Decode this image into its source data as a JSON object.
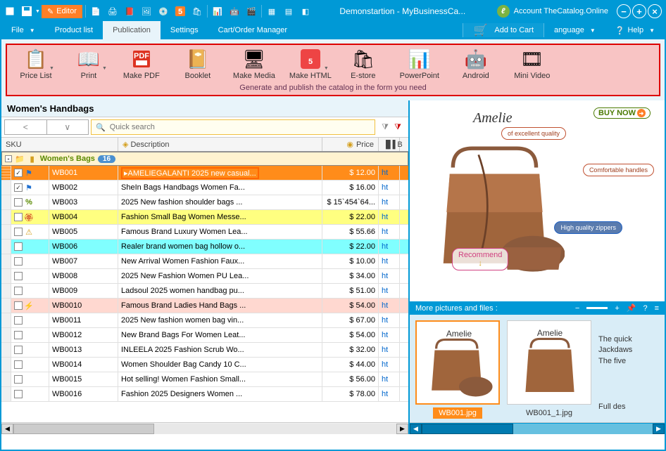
{
  "titlebar": {
    "editor_label": "Editor",
    "title": "Demonstartion - MyBusinessCa...",
    "account": "Account TheCatalog.Online"
  },
  "menubar": {
    "file": "File",
    "product_list": "Product list",
    "publication": "Publication",
    "settings": "Settings",
    "cart": "Cart/Order Manager",
    "add_to_cart": "Add to Cart",
    "language": "anguage",
    "help": "Help"
  },
  "ribbon": {
    "items": [
      "Price List",
      "Print",
      "Make PDF",
      "Booklet",
      "Make Media",
      "Make HTML",
      "E-store",
      "PowerPoint",
      "Android",
      "Mini Video"
    ],
    "desc": "Generate and publish the catalog in the form you need"
  },
  "left": {
    "category": "Women's Handbags",
    "search_placeholder": "Quick search",
    "cols": {
      "sku": "SKU",
      "desc": "Description",
      "price": "Price",
      "b": "B"
    },
    "group": {
      "name": "Women's Bags",
      "count": "16"
    },
    "rows": [
      {
        "sku": "WB001",
        "desc": "AMELIEGALANTI 2025 new casual...",
        "price": "$ 12.00",
        "url": "ht",
        "sel": true,
        "chk": true,
        "ico": "flag-blue"
      },
      {
        "sku": "WB002",
        "desc": "SheIn Bags Handbags Women Fa...",
        "price": "$ 16.00",
        "url": "ht",
        "chk": true,
        "ico": "flag-blue"
      },
      {
        "sku": "WB003",
        "desc": "2025 New fashion shoulder bags ...",
        "price": "$ 15`454`64...",
        "url": "ht",
        "ico": "percent"
      },
      {
        "sku": "WB004",
        "desc": "Fashion Small Bag Women Messe...",
        "price": "$ 22.00",
        "url": "ht",
        "cls": "yellow",
        "ico": "rosette"
      },
      {
        "sku": "WB005",
        "desc": "Famous Brand Luxury Women Lea...",
        "price": "$ 55.66",
        "url": "ht",
        "ico": "warn"
      },
      {
        "sku": "WB006",
        "desc": "Realer brand women bag hollow o...",
        "price": "$ 22.00",
        "url": "ht",
        "cls": "cyan"
      },
      {
        "sku": "WB007",
        "desc": "New Arrival Women Fashion Faux...",
        "price": "$ 10.00",
        "url": "ht"
      },
      {
        "sku": "WB008",
        "desc": "2025 New Fashion Women PU Lea...",
        "price": "$ 34.00",
        "url": "ht"
      },
      {
        "sku": "WB009",
        "desc": "Ladsoul 2025 women handbag pu...",
        "price": "$ 51.00",
        "url": "ht"
      },
      {
        "sku": "WB0010",
        "desc": "Famous Brand Ladies Hand Bags ...",
        "price": "$ 54.00",
        "url": "ht",
        "cls": "pink",
        "ico": "bolt"
      },
      {
        "sku": "WB0011",
        "desc": "2025 New fashion women bag vin...",
        "price": "$ 67.00",
        "url": "ht"
      },
      {
        "sku": "WB0012",
        "desc": "New Brand Bags For Women Leat...",
        "price": "$ 54.00",
        "url": "ht"
      },
      {
        "sku": "WB0013",
        "desc": "INLEELA 2025 Fashion Scrub Wo...",
        "price": "$ 32.00",
        "url": "ht"
      },
      {
        "sku": "WB0014",
        "desc": "Women Shoulder Bag Candy 10 C...",
        "price": "$ 44.00",
        "url": "ht"
      },
      {
        "sku": "WB0015",
        "desc": "Hot selling! Women Fashion Small...",
        "price": "$ 56.00",
        "url": "ht"
      },
      {
        "sku": "WB0016",
        "desc": "Fashion 2025 Designers Women ...",
        "price": "$ 78.00",
        "url": "ht"
      }
    ]
  },
  "preview": {
    "brand": "Amelie",
    "buy": "BUY NOW",
    "callouts": {
      "quality": "of excellent quality",
      "handles": "Comfortable handles",
      "zippers": "High quality zippers",
      "recommend": "Recommend"
    }
  },
  "more": {
    "title": "More pictures and files :",
    "thumbs": [
      "WB001.jpg",
      "WB001_1.jpg"
    ],
    "text": "The quick\nJackdaws\nThe five",
    "fulldes": "Full des"
  }
}
